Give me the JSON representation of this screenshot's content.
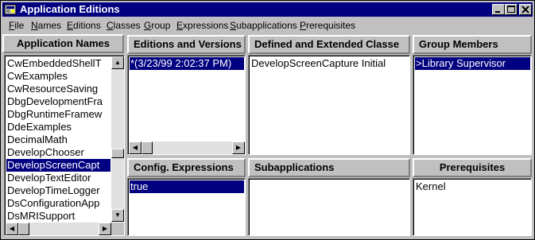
{
  "window": {
    "title": "Application Editions",
    "buttons": {
      "minimize": "_",
      "maximize": "□",
      "close": "✕"
    }
  },
  "menu": [
    {
      "mnemonic": "F",
      "rest": "ile"
    },
    {
      "mnemonic": "N",
      "rest": "ames"
    },
    {
      "mnemonic": "E",
      "rest": "ditions"
    },
    {
      "mnemonic": "C",
      "rest": "lasses"
    },
    {
      "mnemonic": "G",
      "rest": "roup"
    },
    {
      "mnemonic": "E",
      "rest": "xpressions"
    },
    {
      "mnemonic": "S",
      "rest": "ubapplications"
    },
    {
      "mnemonic": "P",
      "rest": "rerequisites"
    }
  ],
  "panes": {
    "application_names": {
      "header": "Application Names",
      "items": [
        "CwEmbeddedShellT",
        "CwExamples",
        "CwResourceSaving",
        "DbgDevelopmentFra",
        "DbgRuntimeFramew",
        "DdeExamples",
        "DecimalMath",
        "DevelopChooser",
        "DevelopScreenCapt",
        "DevelopTextEditor",
        "DevelopTimeLogger",
        "DsConfigurationApp",
        "DsMRISupport"
      ],
      "selected_index": 8
    },
    "editions": {
      "header": "Editions and Versions",
      "items": [
        "*(3/23/99 2:02:37 PM)"
      ],
      "selected_index": 0
    },
    "classes": {
      "header": "Defined and Extended Classe",
      "items": [
        "DevelopScreenCapture Initial"
      ]
    },
    "group": {
      "header": "Group Members",
      "items": [
        ">Library Supervisor"
      ],
      "selected_index": 0
    },
    "expressions": {
      "header": "Config. Expressions",
      "items": [
        "true"
      ],
      "selected_index": 0
    },
    "subapplications": {
      "header": "Subapplications",
      "items": []
    },
    "prerequisites": {
      "header": "Prerequisites",
      "items": [
        "Kernel"
      ]
    }
  },
  "icons": {
    "title": "app-icon",
    "scroll_up": "▲",
    "scroll_down": "▼",
    "scroll_left": "◀",
    "scroll_right": "▶"
  }
}
